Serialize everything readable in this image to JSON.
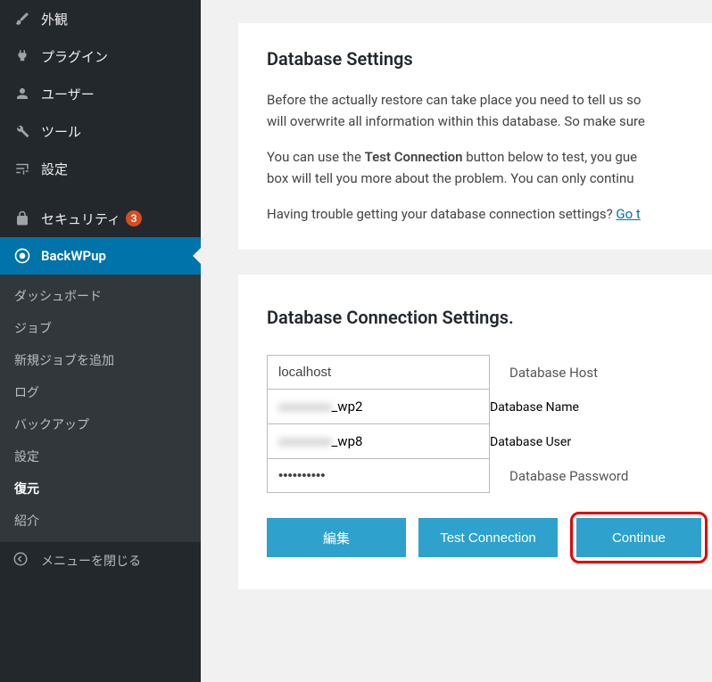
{
  "sidebar": {
    "items": [
      {
        "label": "外観"
      },
      {
        "label": "プラグイン"
      },
      {
        "label": "ユーザー"
      },
      {
        "label": "ツール"
      },
      {
        "label": "設定"
      },
      {
        "label": "セキュリティ",
        "badge": "3"
      },
      {
        "label": "BackWPup"
      }
    ],
    "submenu": [
      "ダッシュボード",
      "ジョブ",
      "新規ジョブを追加",
      "ログ",
      "バックアップ",
      "設定",
      "復元",
      "紹介"
    ],
    "collapse": "メニューを閉じる"
  },
  "panel1": {
    "title": "Database Settings",
    "p1_a": "Before the actually restore can take place you need to tell us so",
    "p1_b": "will overwrite all information within this database. So make sure",
    "p2_a": "You can use the ",
    "p2_bold": "Test Connection",
    "p2_b": " button below to test, you gue",
    "p2_c": "box will tell you more about the problem. You can only continu",
    "p3_a": "Having trouble getting your database connection settings? ",
    "p3_link": "Go t"
  },
  "panel2": {
    "title": "Database Connection Settings.",
    "fields": {
      "host": {
        "value": "localhost",
        "label": "Database Host"
      },
      "name": {
        "value_prefix": "xxxxxxxx",
        "value_suffix": "_wp2",
        "label": "Database Name"
      },
      "user": {
        "value_prefix": "xxxxxxxx",
        "value_suffix": "_wp8",
        "label": "Database User"
      },
      "pass": {
        "value": "••••••••••",
        "label": "Database Password"
      }
    },
    "buttons": {
      "edit": "編集",
      "test": "Test Connection",
      "cont": "Continue"
    }
  }
}
